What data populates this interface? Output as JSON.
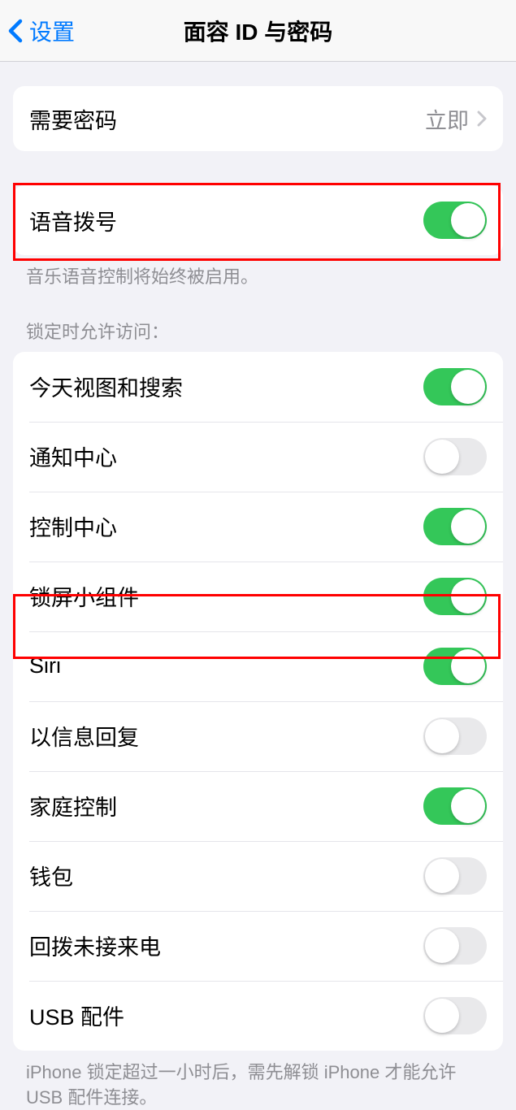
{
  "header": {
    "back_label": "设置",
    "title": "面容 ID 与密码"
  },
  "require_passcode": {
    "label": "需要密码",
    "value": "立即"
  },
  "voice_dial": {
    "label": "语音拨号",
    "enabled": true
  },
  "voice_dial_footer": "音乐语音控制将始终被启用。",
  "lock_screen_header": "锁定时允许访问：",
  "lock_screen_items": [
    {
      "label": "今天视图和搜索",
      "enabled": true
    },
    {
      "label": "通知中心",
      "enabled": false
    },
    {
      "label": "控制中心",
      "enabled": true
    },
    {
      "label": "锁屏小组件",
      "enabled": true
    },
    {
      "label": "Siri",
      "enabled": true
    },
    {
      "label": "以信息回复",
      "enabled": false
    },
    {
      "label": "家庭控制",
      "enabled": true
    },
    {
      "label": "钱包",
      "enabled": false
    },
    {
      "label": "回拨未接来电",
      "enabled": false
    },
    {
      "label": "USB 配件",
      "enabled": false
    }
  ],
  "usb_footer": "iPhone 锁定超过一小时后，需先解锁 iPhone 才能允许 USB 配件连接。",
  "colors": {
    "accent_blue": "#007aff",
    "toggle_green": "#34c759",
    "toggle_off": "#e9e9eb",
    "background": "#f2f2f7",
    "highlight": "#ff0000"
  }
}
